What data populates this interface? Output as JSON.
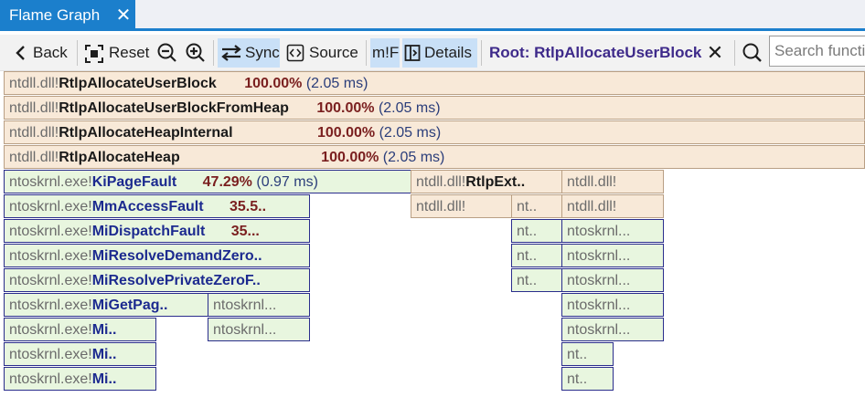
{
  "tab": {
    "title": "Flame Graph",
    "close": "✕"
  },
  "toolbar": {
    "back": "Back",
    "reset": "Reset",
    "sync": "Sync",
    "source": "Source",
    "mf": "m!F",
    "details": "Details",
    "root_label": "Root:",
    "root_value": "RtlpAllocateUserBlock",
    "root_clear": "✕",
    "search_placeholder": "Search functions"
  },
  "colors": {
    "accent": "#1b7fcc",
    "user_frame": "#f8e9d8",
    "kernel_frame": "#e8f6df",
    "kernel_border": "#2a2d8c"
  },
  "frames": {
    "r1": {
      "mod": "ntdll.dll!",
      "fn": "RtlpAllocateUserBlock",
      "pct": "100.00%",
      "ms": "(2.05 ms)"
    },
    "r2": {
      "mod": "ntdll.dll!",
      "fn": "RtlpAllocateUserBlockFromHeap",
      "pct": "100.00%",
      "ms": "(2.05 ms)"
    },
    "r3": {
      "mod": "ntdll.dll!",
      "fn": "RtlpAllocateHeapInternal",
      "pct": "100.00%",
      "ms": "(2.05 ms)"
    },
    "r4": {
      "mod": "ntdll.dll!",
      "fn": "RtlpAllocateHeap",
      "pct": "100.00%",
      "ms": "(2.05 ms)"
    },
    "k1": {
      "mod": "ntoskrnl.exe!",
      "fn": "KiPageFault",
      "pct": "47.29%",
      "ms": "(0.97 ms)"
    },
    "u5a": {
      "mod": "ntdll.dll!",
      "fn": "RtlpExt.."
    },
    "u5b": {
      "mod": "ntdll.dll!"
    },
    "k2": {
      "mod": "ntoskrnl.exe!",
      "fn": "MmAccessFault",
      "pct": "35.5.."
    },
    "u6a": {
      "mod": "ntdll.dll!"
    },
    "u6b": {
      "mod": "nt.."
    },
    "u6c": {
      "mod": "ntdll.dll!"
    },
    "k3": {
      "mod": "ntoskrnl.exe!",
      "fn": "MiDispatchFault",
      "pct": "35..."
    },
    "k3b": {
      "mod": "nt.."
    },
    "k3c": {
      "mod": "ntoskrnl..."
    },
    "k4": {
      "mod": "ntoskrnl.exe!",
      "fn": "MiResolveDemandZero.."
    },
    "k4b": {
      "mod": "nt.."
    },
    "k4c": {
      "mod": "ntoskrnl..."
    },
    "k5": {
      "mod": "ntoskrnl.exe!",
      "fn": "MiResolvePrivateZeroF.."
    },
    "k5b": {
      "mod": "nt.."
    },
    "k5c": {
      "mod": "ntoskrnl..."
    },
    "k6": {
      "mod": "ntoskrnl.exe!",
      "fn": "MiGetPag.."
    },
    "k6b": {
      "mod": "ntoskrnl..."
    },
    "k6c": {
      "mod": "ntoskrnl..."
    },
    "k7": {
      "mod": "ntoskrnl.exe!",
      "fn": "Mi.."
    },
    "k7b": {
      "mod": "ntoskrnl..."
    },
    "k7c": {
      "mod": "ntoskrnl..."
    },
    "k8": {
      "mod": "ntoskrnl.exe!",
      "fn": "Mi.."
    },
    "k8c": {
      "mod": "nt.."
    },
    "k9": {
      "mod": "ntoskrnl.exe!",
      "fn": "Mi.."
    },
    "k9c": {
      "mod": "nt.."
    }
  }
}
